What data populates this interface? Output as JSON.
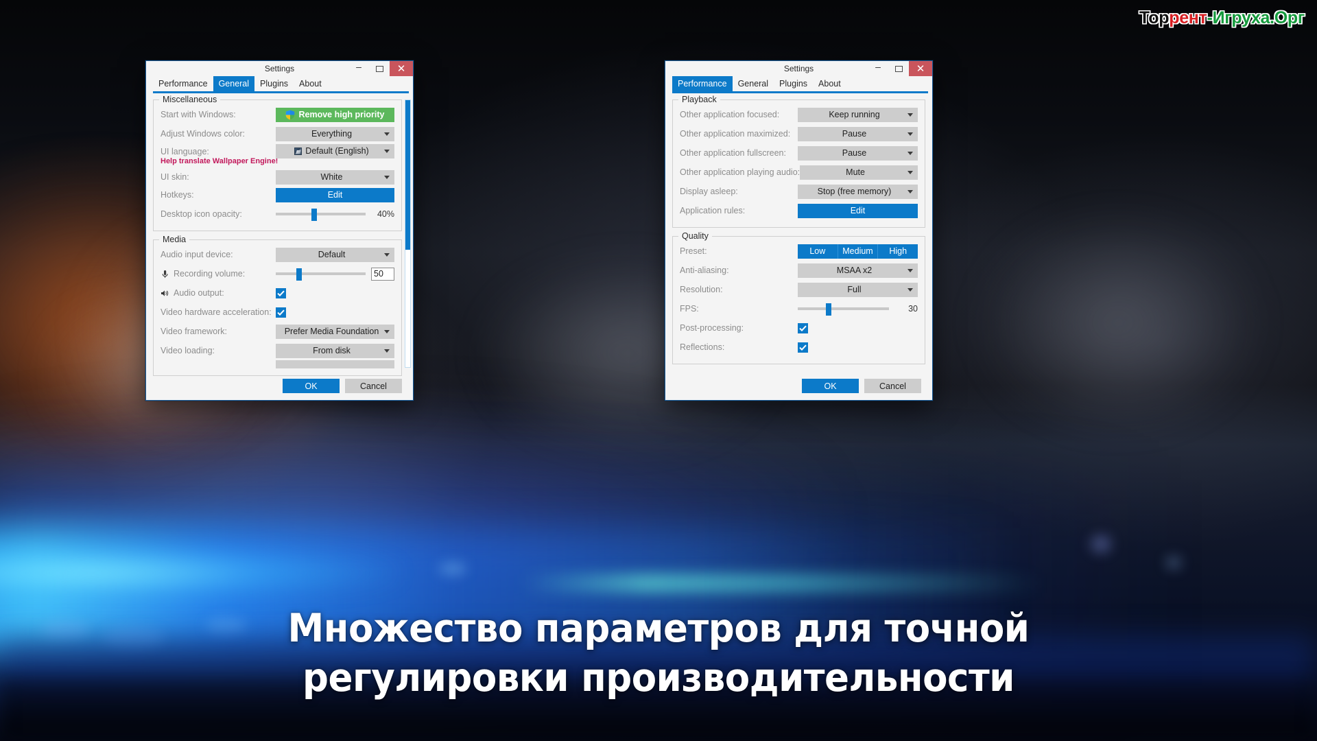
{
  "watermark": {
    "part1": "Тор",
    "part2": "рент",
    "part3": "-Игруха.Орг"
  },
  "caption": {
    "line1": "Множество параметров для точной",
    "line2": "регулировки производительности"
  },
  "colors": {
    "accent_blue": "#0c7ac9",
    "close_red": "#c9555c",
    "green_button": "#5cb85c",
    "link_pink": "#c2185b",
    "combo_grey": "#cdcdcd",
    "dialog_bg": "#f4f4f4"
  },
  "left_dialog": {
    "title": "Settings",
    "window_buttons": {
      "minimize": "minimize-icon",
      "maximize": "maximize-icon",
      "close": "close-icon"
    },
    "tabs": [
      {
        "label": "Performance",
        "active": false
      },
      {
        "label": "General",
        "active": true
      },
      {
        "label": "Plugins",
        "active": false
      },
      {
        "label": "About",
        "active": false
      }
    ],
    "groups": [
      {
        "title": "Miscellaneous",
        "rows": [
          {
            "label": "Start with Windows:",
            "type": "shield-button",
            "value": "Remove high priority"
          },
          {
            "label": "Adjust Windows color:",
            "type": "combo",
            "value": "Everything"
          },
          {
            "label": "UI language:",
            "type": "combo",
            "value": "Default (English)",
            "icon": "flag-icon",
            "sublink": "Help translate Wallpaper Engine!"
          },
          {
            "label": "UI skin:",
            "type": "combo",
            "value": "White"
          },
          {
            "label": "Hotkeys:",
            "type": "blue-button",
            "value": "Edit"
          },
          {
            "label": "Desktop icon opacity:",
            "type": "slider",
            "value": "40%",
            "percent": 40
          }
        ]
      },
      {
        "title": "Media",
        "rows": [
          {
            "label": "Audio input device:",
            "type": "combo",
            "value": "Default"
          },
          {
            "label": "Recording volume:",
            "type": "slider-input",
            "value": "50",
            "percent": 23,
            "icon": "microphone-icon"
          },
          {
            "label": "Audio output:",
            "type": "checkbox",
            "checked": true,
            "icon": "speaker-icon"
          },
          {
            "label": "Video hardware acceleration:",
            "type": "checkbox",
            "checked": true
          },
          {
            "label": "Video framework:",
            "type": "combo",
            "value": "Prefer Media Foundation"
          },
          {
            "label": "Video loading:",
            "type": "combo",
            "value": "From disk"
          }
        ]
      }
    ],
    "footer": {
      "ok": "OK",
      "cancel": "Cancel"
    }
  },
  "right_dialog": {
    "title": "Settings",
    "window_buttons": {
      "minimize": "minimize-icon",
      "maximize": "maximize-icon",
      "close": "close-icon"
    },
    "tabs": [
      {
        "label": "Performance",
        "active": true
      },
      {
        "label": "General",
        "active": false
      },
      {
        "label": "Plugins",
        "active": false
      },
      {
        "label": "About",
        "active": false
      }
    ],
    "groups": [
      {
        "title": "Playback",
        "rows": [
          {
            "label": "Other application focused:",
            "type": "combo",
            "value": "Keep running"
          },
          {
            "label": "Other application maximized:",
            "type": "combo",
            "value": "Pause"
          },
          {
            "label": "Other application fullscreen:",
            "type": "combo",
            "value": "Pause"
          },
          {
            "label": "Other application playing audio:",
            "type": "combo",
            "value": "Mute"
          },
          {
            "label": "Display asleep:",
            "type": "combo",
            "value": "Stop (free memory)"
          },
          {
            "label": "Application rules:",
            "type": "blue-button",
            "value": "Edit"
          }
        ]
      },
      {
        "title": "Quality",
        "rows": [
          {
            "label": "Preset:",
            "type": "segmented",
            "options": [
              "Low",
              "Medium",
              "High"
            ]
          },
          {
            "label": "Anti-aliasing:",
            "type": "combo",
            "value": "MSAA x2"
          },
          {
            "label": "Resolution:",
            "type": "combo",
            "value": "Full"
          },
          {
            "label": "FPS:",
            "type": "slider",
            "value": "30",
            "percent": 31
          },
          {
            "label": "Post-processing:",
            "type": "checkbox",
            "checked": true
          },
          {
            "label": "Reflections:",
            "type": "checkbox",
            "checked": true
          }
        ]
      }
    ],
    "footer": {
      "ok": "OK",
      "cancel": "Cancel"
    }
  }
}
